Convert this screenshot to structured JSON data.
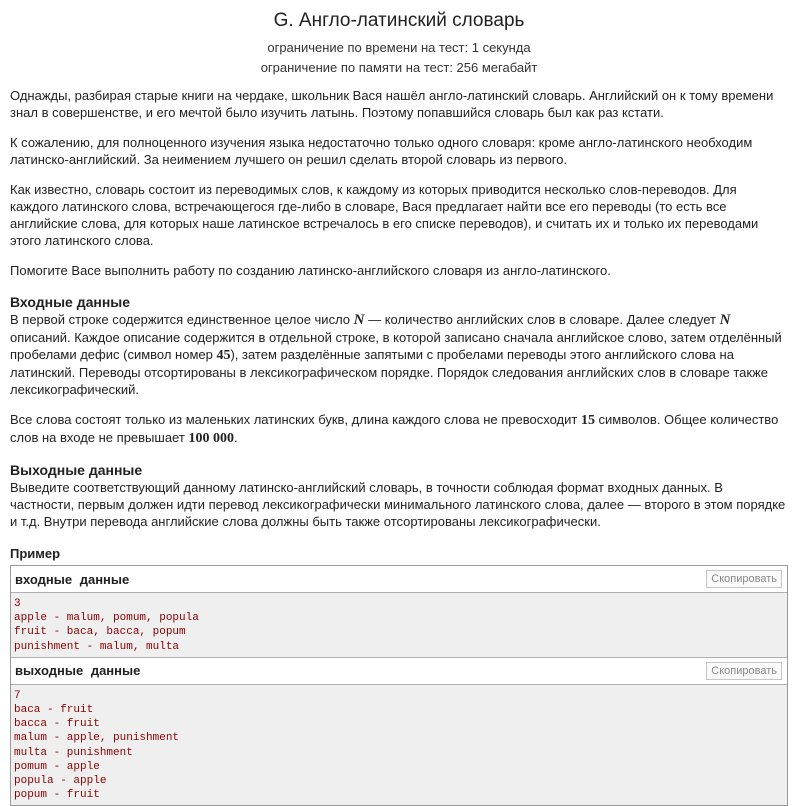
{
  "header": {
    "title": "G. Англо-латинский словарь",
    "time_limit": "ограничение по времени на тест: 1 секунда",
    "memory_limit": "ограничение по памяти на тест: 256 мегабайт"
  },
  "legend": {
    "p1": "Однажды, разбирая старые книги на чердаке, школьник Вася нашёл англо-латинский словарь. Английский он к тому времени знал в совершенстве, и его мечтой было изучить латынь. Поэтому попавшийся словарь был как раз кстати.",
    "p2": "К сожалению, для полноценного изучения языка недостаточно только одного словаря: кроме англо-латинского необходим латинско-английский. За неимением лучшего он решил сделать второй словарь из первого.",
    "p3": "Как известно, словарь состоит из переводимых слов, к каждому из которых приводится несколько слов-переводов. Для каждого латинского слова, встречающегося где-либо в словаре, Вася предлагает найти все его переводы (то есть все английские слова, для которых наше латинское встречалось в его списке переводов), и считать их и только их переводами этого латинского слова.",
    "p4": "Помогите Васе выполнить работу по созданию латинско-английского словаря из англо-латинского."
  },
  "input_section": {
    "title": "Входные данные",
    "p1_a": "В первой строке содержится единственное целое число ",
    "var_n": "N",
    "p1_b": " — количество английских слов в словаре. Далее следует ",
    "p1_c": " описаний. Каждое описание содержится в отдельной строке, в которой записано сначала английское слово, затем отделённый пробелами дефис (символ номер ",
    "num_45": "45",
    "p1_d": "), затем разделённые запятыми с пробелами переводы этого английского слова на латинский. Переводы отсортированы в лексикографическом порядке. Порядок следования английских слов в словаре также лексикографический.",
    "p2_a": "Все слова состоят только из маленьких латинских букв, длина каждого слова не превосходит ",
    "num_15": "15",
    "p2_b": " символов. Общее количество слов на входе не превышает ",
    "num_100000": "100 000",
    "p2_c": "."
  },
  "output_section": {
    "title": "Выходные данные",
    "p1": "Выведите соответствующий данному латинско-английский словарь, в точности соблюдая формат входных данных. В частности, первым должен идти перевод лексикографически минимального латинского слова, далее — второго в этом порядке и т.д. Внутри перевода английские слова должны быть также отсортированы лексикографически."
  },
  "example": {
    "title": "Пример",
    "input_label": "входные данные",
    "output_label": "выходные данные",
    "copy_label": "Скопировать",
    "input_text": "3\napple - malum, pomum, popula\nfruit - baca, bacca, popum\npunishment - malum, multa",
    "output_text": "7\nbaca - fruit\nbacca - fruit\nmalum - apple, punishment\nmulta - punishment\npomum - apple\npopula - apple\npopum - fruit"
  }
}
